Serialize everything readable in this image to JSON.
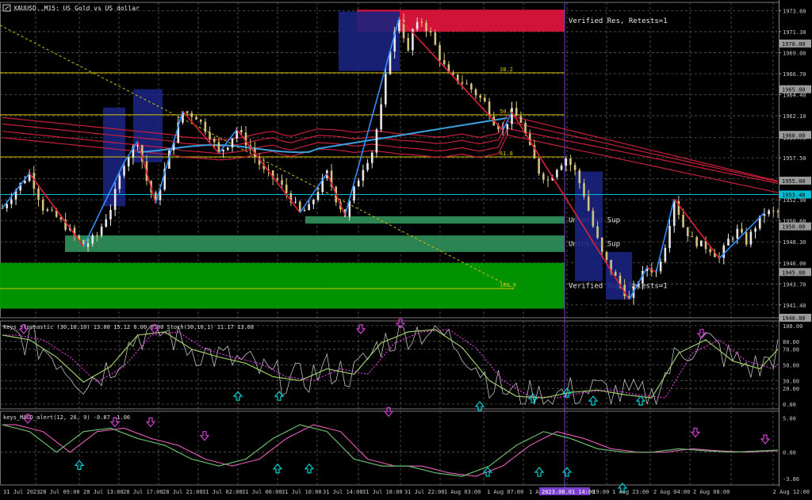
{
  "header": {
    "title": "XAUUSD.,M15:  US Gold vs US dollar"
  },
  "colors": {
    "background": "#000000",
    "grid": "#5a5a5a",
    "axis_text": "#c8c8c8",
    "up_candle": "#e8e8e8",
    "down_candle": "#d4c27a",
    "resistance_zone": "#dc143c",
    "support_zone_light": "#2e8b57",
    "support_zone_dark": "#009a00",
    "blue_box": "#1a237e",
    "zigzag_red": "#e0203a",
    "zigzag_blue": "#2f8fff",
    "fib_line": "#d4c200",
    "trendline": "#d4c200",
    "bid_line": "#00bcd4",
    "ma_red": "#c8203a",
    "ma_blue": "#3aa0e0",
    "stoch_main": "#9ccc65",
    "stoch_signal": "#ff40ff",
    "stoch_raw": "#c0c0c0",
    "macd_main": "#66bb6a",
    "macd_signal": "#ff66cc",
    "arrow_up": "#00d0d0",
    "arrow_down": "#d040d0",
    "vline": "#7b3fd0"
  },
  "time_axis": {
    "labels": [
      "31 Jul 2023",
      "28 Jul 09:00",
      "28 Jul 13:00",
      "28 Jul 17:00",
      "28 Jul 21:00",
      "31 Jul 02:00",
      "31 Jul 06:00",
      "31 Jul 10:00",
      "31 Jul 14:00",
      "31 Jul 18:00",
      "31 Jul 22:00",
      "1 Aug 03:00",
      "1 Aug 07:00",
      "1 Aug 15:00",
      "1 Aug 19:00",
      "1 Aug 23:00",
      "2 Aug 04:00",
      "2 Aug 08:00",
      "2 Aug 12:00"
    ],
    "highlight_label": "2023.08.01 14:00"
  },
  "main_panel": {
    "price_ticks": [
      "1973.60",
      "1971.30",
      "1969.00",
      "1966.70",
      "1964.40",
      "1962.10",
      "1959.70",
      "1957.50",
      "1955.20",
      "1952.90",
      "1950.60",
      "1948.30",
      "1946.00",
      "1943.70",
      "1941.40"
    ],
    "price_tags": [
      {
        "label": "1970.00",
        "value": 1970.0
      },
      {
        "label": "1965.00",
        "value": 1965.0
      },
      {
        "label": "1960.00",
        "value": 1960.0
      },
      {
        "label": "1955.00",
        "value": 1955.0
      },
      {
        "label": "1953.48",
        "value": 1953.48,
        "current": true
      },
      {
        "label": "1950.00",
        "value": 1950.0
      },
      {
        "label": "1945.00",
        "value": 1945.0
      },
      {
        "label": "1940.00",
        "value": 1940.0
      }
    ],
    "zones": [
      {
        "label": "Verified Res, Retests=1",
        "top": 1973.7,
        "bottom": 1971.3,
        "color": "resistance"
      },
      {
        "label": "Untested Sup",
        "top": 1951.1,
        "bottom": 1950.3,
        "color": "light"
      },
      {
        "label": "Untested Sup",
        "top": 1949.0,
        "bottom": 1947.2,
        "color": "light"
      },
      {
        "label": "Verified Sup, Retests=1",
        "top": 1946.0,
        "bottom": 1941.0,
        "color": "dark"
      }
    ],
    "fib_levels": [
      {
        "label": "38.2",
        "value": 1966.8
      },
      {
        "label": "50.0",
        "value": 1962.2
      },
      {
        "label": "61.8",
        "value": 1957.6
      },
      {
        "label": "100.0",
        "value": 1943.2
      }
    ]
  },
  "stoch_panel": {
    "title": "keys_stochastic (30,10,10) 13.08 15.12 0.00 0.00 Stoch(30,10,1) 11.17 13.08",
    "ticks": [
      "100.00",
      "80.00",
      "70.00",
      "50.00",
      "30.00",
      "20.00",
      "0.00"
    ]
  },
  "macd_panel": {
    "title": "keys_MACD_alert(12, 26, 9) -0.87 -1.06",
    "ticks": [
      "5.00",
      "0.00",
      "-3.86"
    ]
  },
  "chart_data": {
    "type": "line",
    "symbol": "XAUUSD.",
    "timeframe": "M15",
    "ylim": [
      1940.0,
      1974.5
    ],
    "x_tick_labels": [
      "31 Jul 2023",
      "28 Jul 09:00",
      "28 Jul 13:00",
      "28 Jul 17:00",
      "28 Jul 21:00",
      "31 Jul 02:00",
      "31 Jul 06:00",
      "31 Jul 10:00",
      "31 Jul 14:00",
      "31 Jul 18:00",
      "31 Jul 22:00",
      "1 Aug 03:00",
      "1 Aug 07:00",
      "1 Aug 15:00",
      "1 Aug 19:00",
      "1 Aug 23:00",
      "2 Aug 04:00",
      "2 Aug 08:00",
      "2 Aug 12:00"
    ],
    "price_path": [
      [
        0,
        1952
      ],
      [
        3,
        1954
      ],
      [
        6,
        1955.8
      ],
      [
        9,
        1952
      ],
      [
        12,
        1951
      ],
      [
        15,
        1949.5
      ],
      [
        18,
        1947.8
      ],
      [
        21,
        1949
      ],
      [
        24,
        1952
      ],
      [
        27,
        1957
      ],
      [
        30,
        1959.3
      ],
      [
        32,
        1955
      ],
      [
        34,
        1952.5
      ],
      [
        37,
        1958
      ],
      [
        40,
        1962.6
      ],
      [
        43,
        1962
      ],
      [
        46,
        1960
      ],
      [
        48,
        1958
      ],
      [
        50,
        1959
      ],
      [
        52,
        1960.6
      ],
      [
        55,
        1958.5
      ],
      [
        58,
        1956
      ],
      [
        61,
        1955
      ],
      [
        64,
        1953
      ],
      [
        66,
        1951.5
      ],
      [
        68,
        1952
      ],
      [
        70,
        1954
      ],
      [
        72,
        1955.8
      ],
      [
        74,
        1953
      ],
      [
        76,
        1951.2
      ],
      [
        78,
        1954
      ],
      [
        80,
        1956.5
      ],
      [
        82,
        1958.2
      ],
      [
        84,
        1963
      ],
      [
        86,
        1969.5
      ],
      [
        88,
        1972.8
      ],
      [
        90,
        1969
      ],
      [
        91,
        1971.5
      ],
      [
        93,
        1972.4
      ],
      [
        95,
        1971
      ],
      [
        97,
        1968.5
      ],
      [
        99,
        1966.5
      ],
      [
        101,
        1966
      ],
      [
        103,
        1965.5
      ],
      [
        105,
        1964.5
      ],
      [
        107,
        1963.5
      ],
      [
        109,
        1961.5
      ],
      [
        111,
        1960.5
      ],
      [
        113,
        1962.5
      ],
      [
        115,
        1961.5
      ],
      [
        117,
        1958.5
      ],
      [
        119,
        1956
      ],
      [
        121,
        1955
      ],
      [
        123,
        1956.5
      ],
      [
        125,
        1957.5
      ],
      [
        127,
        1956
      ],
      [
        129,
        1953.5
      ],
      [
        131,
        1950
      ],
      [
        133,
        1947
      ],
      [
        135,
        1945.2
      ],
      [
        137,
        1943.6
      ],
      [
        139,
        1942
      ],
      [
        141,
        1944
      ],
      [
        143,
        1945.5
      ],
      [
        145,
        1945
      ],
      [
        147,
        1948
      ],
      [
        149,
        1953
      ],
      [
        151,
        1950
      ],
      [
        153,
        1948.5
      ],
      [
        155,
        1948
      ],
      [
        157,
        1947.5
      ],
      [
        159,
        1946.5
      ],
      [
        161,
        1948.5
      ],
      [
        163,
        1949.5
      ],
      [
        165,
        1948.3
      ],
      [
        167,
        1950
      ],
      [
        169,
        1951.5
      ]
    ],
    "stoch_main": [
      [
        0,
        88
      ],
      [
        6,
        82
      ],
      [
        12,
        60
      ],
      [
        18,
        28
      ],
      [
        24,
        48
      ],
      [
        30,
        88
      ],
      [
        36,
        92
      ],
      [
        42,
        70
      ],
      [
        48,
        60
      ],
      [
        54,
        52
      ],
      [
        60,
        35
      ],
      [
        66,
        30
      ],
      [
        72,
        45
      ],
      [
        78,
        38
      ],
      [
        84,
        78
      ],
      [
        90,
        92
      ],
      [
        96,
        95
      ],
      [
        102,
        72
      ],
      [
        108,
        30
      ],
      [
        114,
        10
      ],
      [
        120,
        8
      ],
      [
        126,
        15
      ],
      [
        132,
        18
      ],
      [
        138,
        12
      ],
      [
        144,
        8
      ],
      [
        150,
        65
      ],
      [
        156,
        82
      ],
      [
        162,
        55
      ],
      [
        168,
        45
      ],
      [
        172,
        70
      ]
    ],
    "macd_main": [
      [
        0,
        4
      ],
      [
        6,
        3
      ],
      [
        12,
        0
      ],
      [
        18,
        3
      ],
      [
        24,
        3.5
      ],
      [
        30,
        2
      ],
      [
        36,
        1
      ],
      [
        42,
        -1
      ],
      [
        48,
        -2
      ],
      [
        54,
        -1
      ],
      [
        60,
        2
      ],
      [
        66,
        4
      ],
      [
        72,
        3
      ],
      [
        78,
        -1
      ],
      [
        84,
        -2
      ],
      [
        90,
        -2
      ],
      [
        96,
        -3
      ],
      [
        102,
        -3.5
      ],
      [
        108,
        -2
      ],
      [
        114,
        1
      ],
      [
        120,
        3
      ],
      [
        126,
        2
      ],
      [
        132,
        0.5
      ],
      [
        138,
        0
      ],
      [
        144,
        0
      ],
      [
        150,
        0.5
      ],
      [
        156,
        0.2
      ],
      [
        162,
        0
      ],
      [
        168,
        0.2
      ],
      [
        172,
        0.3
      ]
    ]
  }
}
